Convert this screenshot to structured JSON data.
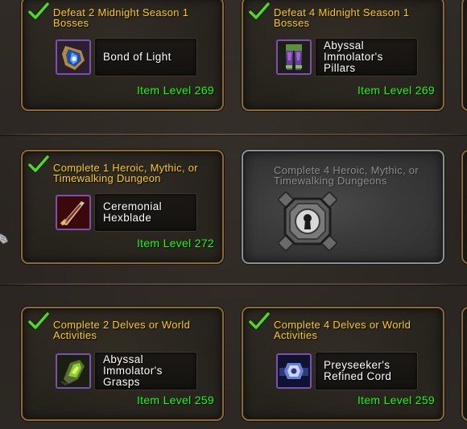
{
  "rows": [
    {
      "cards": [
        {
          "completed": true,
          "title": "Defeat 2 Midnight Season 1 Bosses",
          "item_name": "Bond of Light",
          "item_level": "Item Level 269",
          "icon": "helmet-icon"
        },
        {
          "completed": true,
          "title": "Defeat 4 Midnight Season 1 Bosses",
          "item_name": "Abyssal Immolator's Pillars",
          "item_level": "Item Level 269",
          "icon": "leggings-icon"
        }
      ]
    },
    {
      "cards": [
        {
          "completed": true,
          "title": "Complete 1 Heroic, Mythic, or Timewalking Dungeon",
          "item_name": "Ceremonial Hexblade",
          "item_level": "Item Level 272",
          "icon": "dagger-icon"
        },
        {
          "completed": false,
          "locked": true,
          "title": "Complete 4 Heroic, Mythic, or Timewalking Dungeons",
          "icon": "lock-icon"
        }
      ]
    },
    {
      "cards": [
        {
          "completed": true,
          "title": "Complete 2 Delves or World Activities",
          "item_name": "Abyssal Immolator's Grasps",
          "item_level": "Item Level 259",
          "icon": "gauntlet-icon"
        },
        {
          "completed": true,
          "title": "Complete 4 Delves or World Activities",
          "item_name": "Preyseeker's Refined Cord",
          "item_level": "Item Level 259",
          "icon": "belt-icon"
        }
      ]
    }
  ],
  "colors": {
    "title_gold": "#ffd000",
    "item_level_green": "#1eff00",
    "epic_border": "#7e4fb0",
    "card_border": "#8a6a35",
    "locked_title": "#8a8a8a"
  }
}
